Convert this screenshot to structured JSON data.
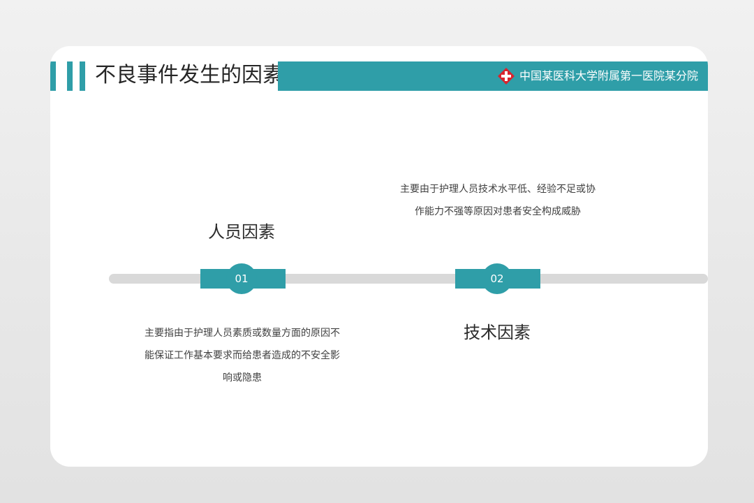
{
  "header": {
    "title": "不良事件发生的因素",
    "organization": "中国某医科大学附属第一医院某分院",
    "logo_icon": "red-cross-icon"
  },
  "timeline": {
    "items": [
      {
        "number": "01",
        "title": "人员因素",
        "description": "主要指由于护理人员素质或数量方面的原因不能保证工作基本要求而给患者造成的不安全影响或隐患"
      },
      {
        "number": "02",
        "title": "技术因素",
        "description": "主要由于护理人员技术水平低、经验不足或协作能力不强等原因对患者安全构成威胁"
      }
    ]
  },
  "colors": {
    "accent": "#2f9ea8",
    "track": "#d9d9d9",
    "logo_red": "#d9232d"
  }
}
